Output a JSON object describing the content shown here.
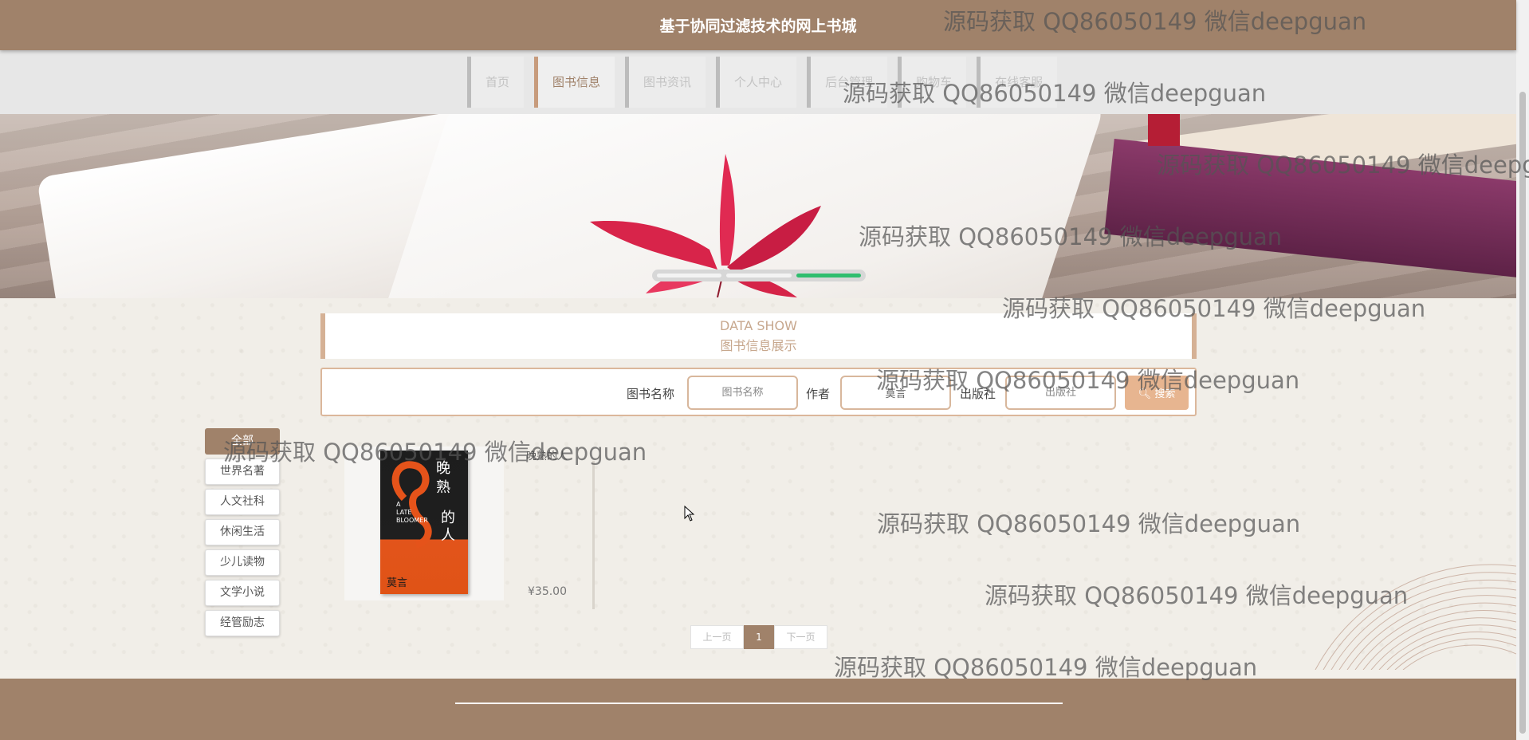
{
  "header": {
    "site_title": "基于协同过滤技术的网上书城"
  },
  "nav": {
    "items": [
      {
        "label": "首页"
      },
      {
        "label": "图书信息"
      },
      {
        "label": "图书资讯"
      },
      {
        "label": "个人中心"
      },
      {
        "label": "后台管理"
      },
      {
        "label": "购物车"
      },
      {
        "label": "在线客服"
      }
    ],
    "active_index": 1
  },
  "banner": {
    "slides": 3,
    "active_slide": 3
  },
  "section": {
    "title_en": "DATA SHOW",
    "title_cn": "图书信息展示"
  },
  "search": {
    "name_label": "图书名称",
    "name_placeholder": "图书名称",
    "author_label": "作者",
    "author_value": "莫言",
    "publisher_label": "出版社",
    "publisher_placeholder": "出版社",
    "button_label": "搜索"
  },
  "categories": {
    "all_label": "全部",
    "items": [
      "世界名著",
      "人文社科",
      "休闲生活",
      "少儿读物",
      "文学小说",
      "经管励志"
    ]
  },
  "products": [
    {
      "name": "晚熟的人",
      "price": "¥35.00",
      "cover_title": "晚熟的人",
      "cover_en": "A LATE BLOOMER",
      "cover_author": "莫言"
    }
  ],
  "pagination": {
    "prev": "上一页",
    "current": "1",
    "next": "下一页"
  },
  "watermark": "源码获取 QQ86050149 微信deepguan",
  "colors": {
    "brand": "#a0826a",
    "accent": "#d5b195",
    "active_dot": "#2fbe6e"
  }
}
